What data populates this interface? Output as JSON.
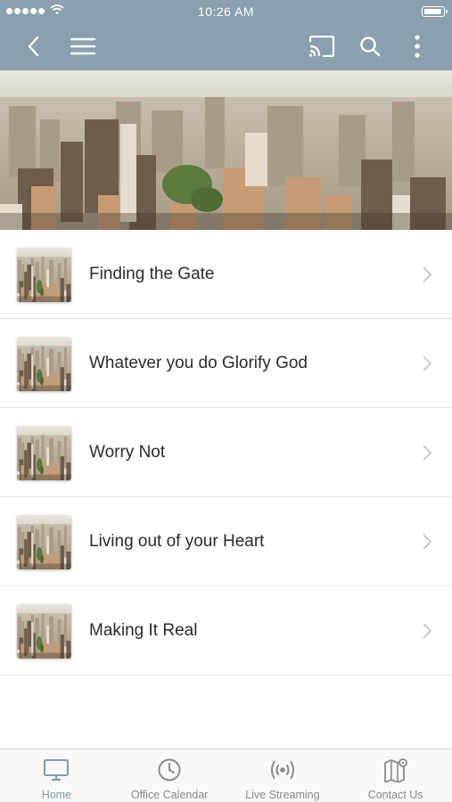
{
  "status_bar": {
    "time": "10:26 AM"
  },
  "colors": {
    "nav_bar": "#8aa0ae",
    "tab_active": "#7f9aab",
    "tab_inactive": "#8a8a8a"
  },
  "header": {
    "icons": [
      "back-icon",
      "menu-icon",
      "cast-icon",
      "search-icon",
      "more-icon"
    ]
  },
  "list": {
    "items": [
      {
        "title": "Finding the Gate"
      },
      {
        "title": "Whatever you do Glorify God"
      },
      {
        "title": "Worry Not"
      },
      {
        "title": "Living out of your Heart"
      },
      {
        "title": "Making It Real"
      }
    ]
  },
  "tabbar": {
    "active": "Home",
    "tabs": [
      {
        "label": "Home",
        "icon": "monitor-icon"
      },
      {
        "label": "Office Calendar",
        "icon": "clock-icon"
      },
      {
        "label": "Live Streaming",
        "icon": "broadcast-icon"
      },
      {
        "label": "Contact Us",
        "icon": "map-pin-icon"
      }
    ]
  }
}
